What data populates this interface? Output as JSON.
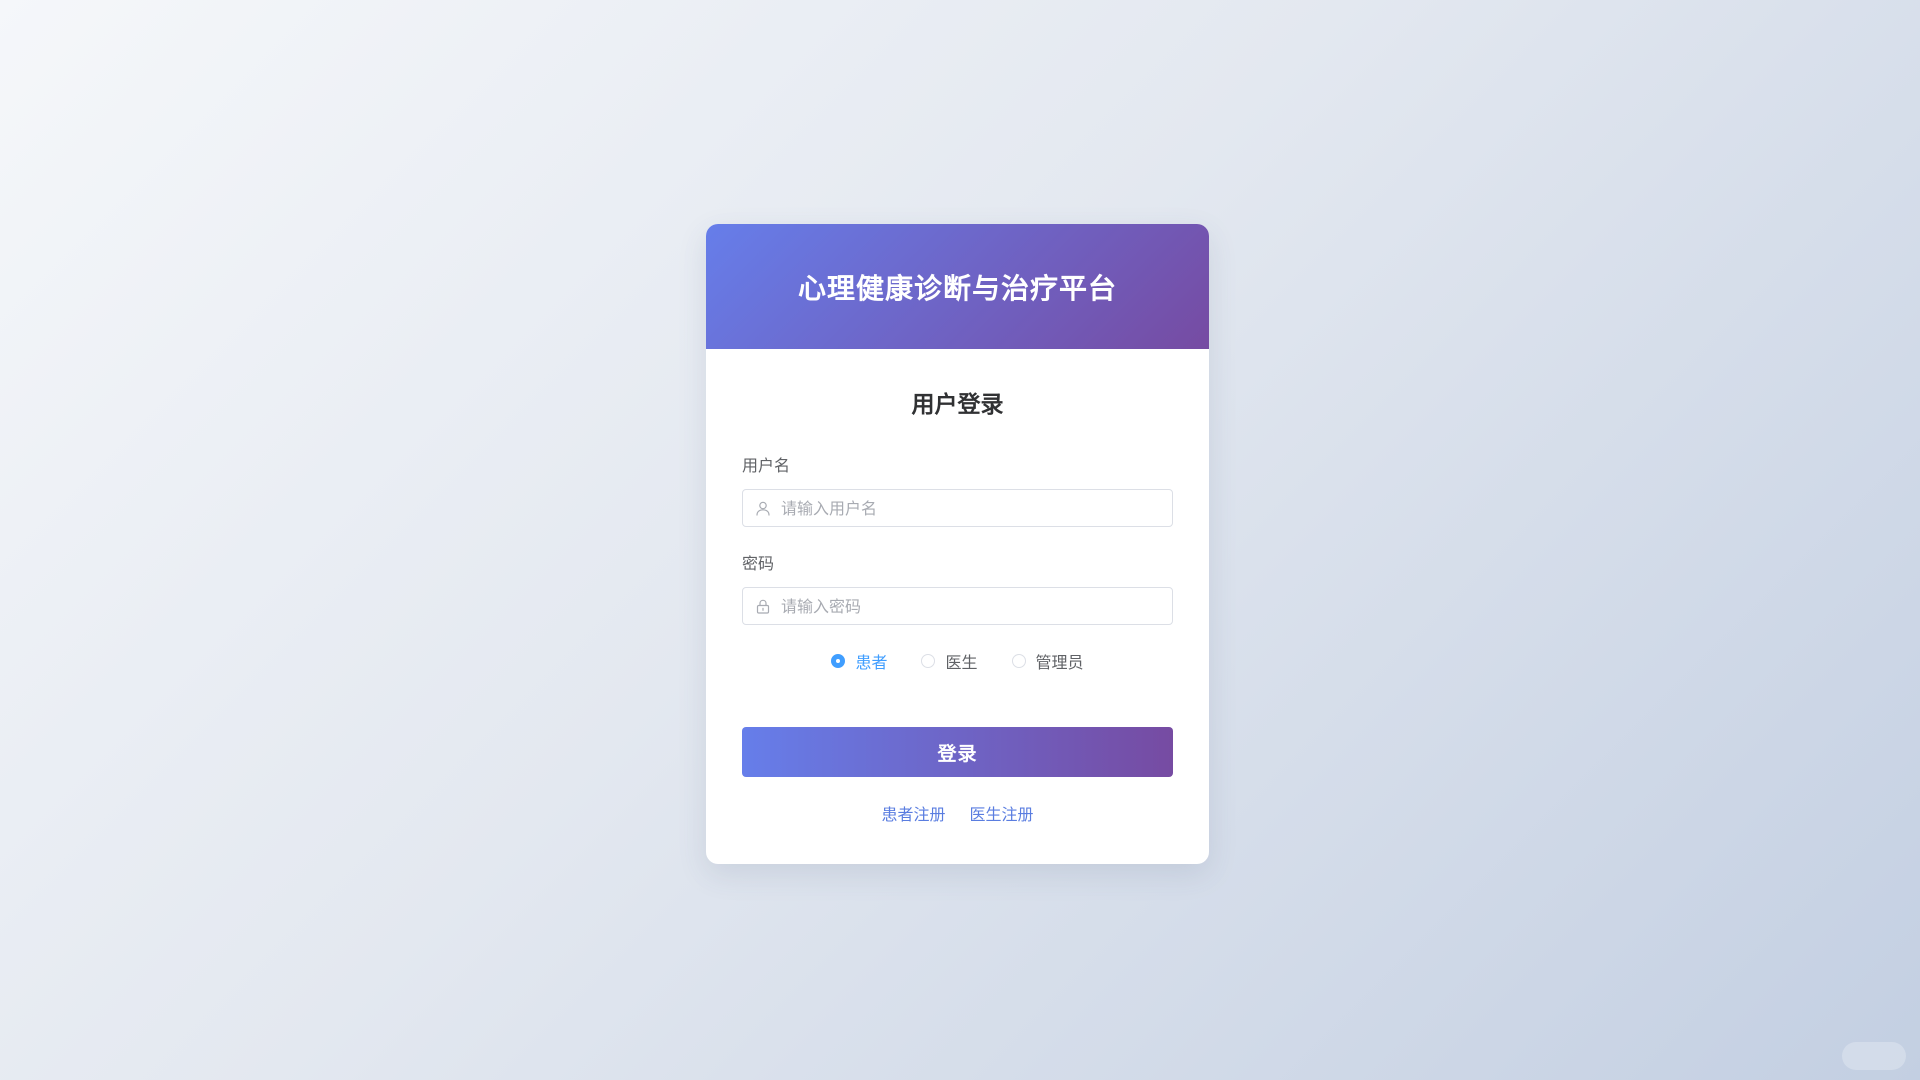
{
  "header": {
    "platform_title": "心理健康诊断与治疗平台"
  },
  "login": {
    "title": "用户登录",
    "username": {
      "label": "用户名",
      "placeholder": "请输入用户名",
      "value": "",
      "icon": "user-icon"
    },
    "password": {
      "label": "密码",
      "placeholder": "请输入密码",
      "value": "",
      "icon": "lock-icon"
    },
    "roles": [
      {
        "label": "患者",
        "checked": true
      },
      {
        "label": "医生",
        "checked": false
      },
      {
        "label": "管理员",
        "checked": false
      }
    ],
    "submit_label": "登录",
    "links": {
      "patient_register": "患者注册",
      "doctor_register": "医生注册"
    }
  },
  "colors": {
    "gradient_start": "#667eea",
    "gradient_end": "#764ba2",
    "radio_active": "#409eff",
    "link": "#5a7de0"
  }
}
